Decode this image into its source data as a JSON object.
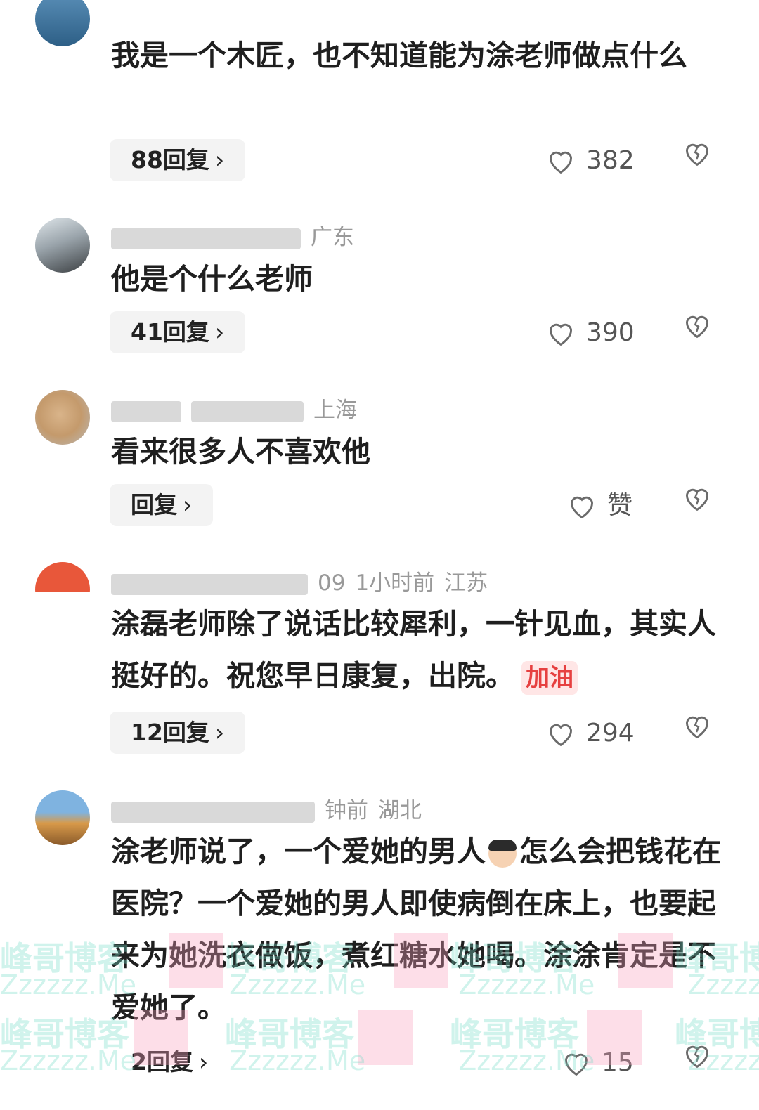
{
  "comments": [
    {
      "meta_user": "",
      "meta_time": "",
      "location": "",
      "text": "我是一个木匠，也不知道能为涂老师做点什么",
      "reply_label": "88回复",
      "likes": "382"
    },
    {
      "meta_user": "",
      "meta_time": "",
      "location": "广东",
      "text": "他是个什么老师",
      "reply_label": "41回复",
      "likes": "390"
    },
    {
      "meta_user": "",
      "meta_time": "",
      "location": "上海",
      "text": "看来很多人不喜欢他",
      "reply_label": "回复",
      "likes": "赞"
    },
    {
      "meta_user": "09",
      "meta_time": "1小时前",
      "location": "江苏",
      "text": "涂磊老师除了说话比较犀利，一针见血，其实人挺好的。祝您早日康复，出院。",
      "sticker": "加油",
      "reply_label": "12回复",
      "likes": "294"
    },
    {
      "meta_user": "",
      "meta_time": "钟前",
      "location": "湖北",
      "text_part1": "涂老师说了，一个爱她的男人",
      "text_part2": "怎么会把钱花在医院？一个爱她的男人即使病倒在床上，也要起来为她洗衣做饭，煮红糖水她喝。涂涂肯定是不爱她了。",
      "reply_label": "2回复",
      "likes": "15"
    }
  ],
  "chevron": "›",
  "watermark": {
    "line1": "峰哥博客",
    "line2": "Zzzzzz.Me"
  },
  "colors": {
    "heart_outline": "#6b6b6b",
    "meta_text": "#999999",
    "reply_bg": "#f3f3f3"
  }
}
